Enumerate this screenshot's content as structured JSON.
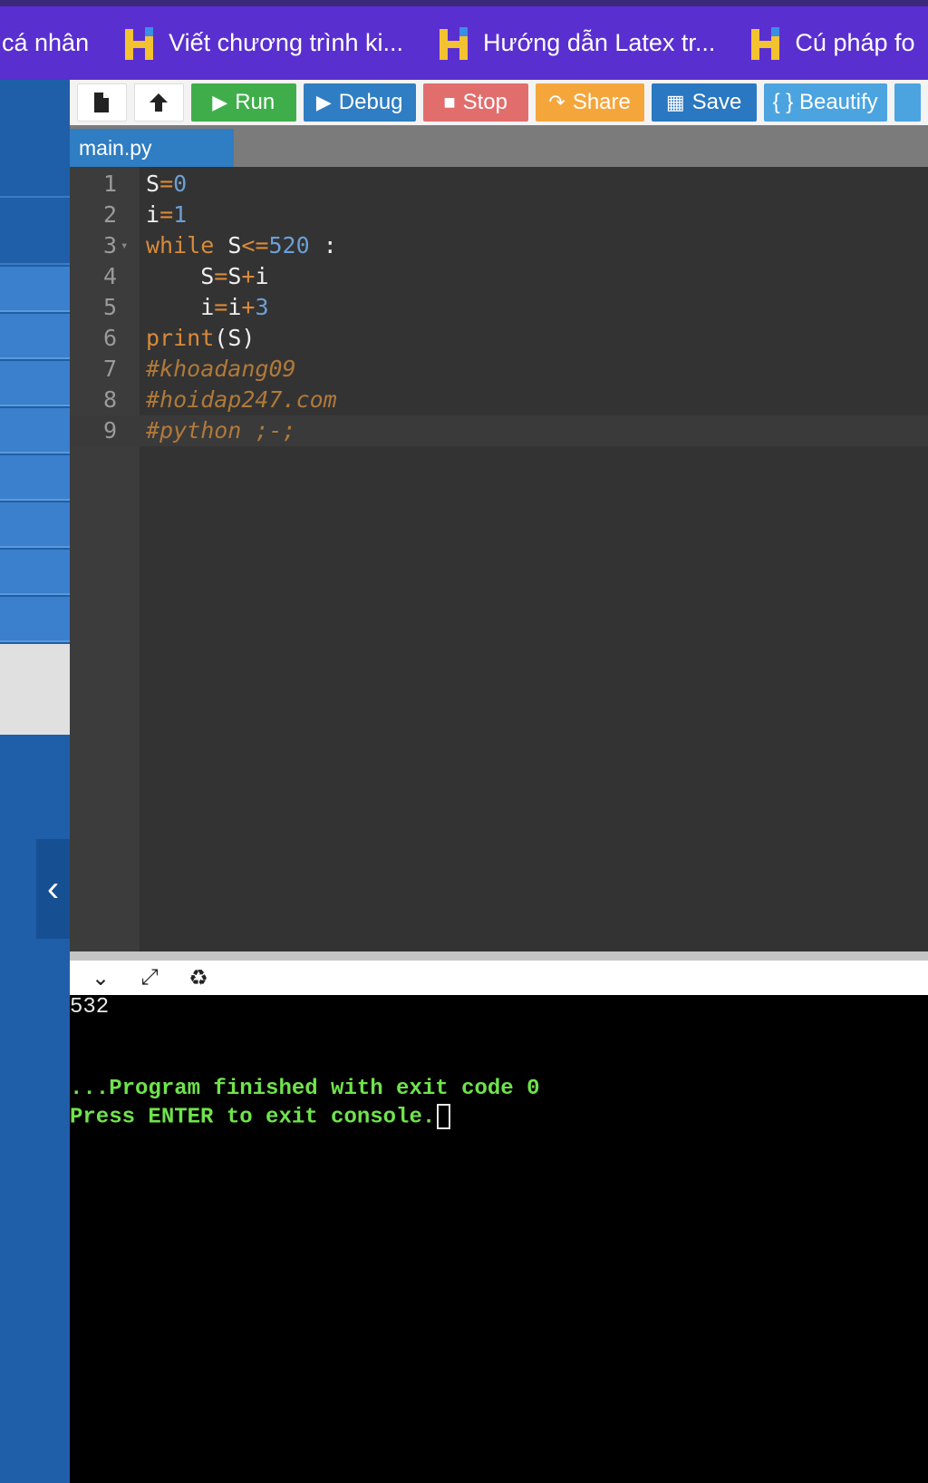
{
  "bookmarks": [
    {
      "label": "cá nhân",
      "icon": "none"
    },
    {
      "label": "Viết chương trình ki...",
      "icon": "h-logo-icon"
    },
    {
      "label": "Hướng dẫn Latex tr...",
      "icon": "h-logo-icon"
    },
    {
      "label": "Cú pháp fo",
      "icon": "h-logo-icon"
    }
  ],
  "toolbar": {
    "run_label": "Run",
    "debug_label": "Debug",
    "stop_label": "Stop",
    "share_label": "Share",
    "save_label": "Save",
    "beautify_label": "{ } Beautify"
  },
  "tab": {
    "filename": "main.py"
  },
  "editor": {
    "lines": [
      "1",
      "2",
      "3",
      "4",
      "5",
      "6",
      "7",
      "8",
      "9"
    ]
  },
  "console": {
    "output_value": "532",
    "finished_msg": "...Program finished with exit code 0",
    "press_msg": "Press ENTER to exit console."
  },
  "colors": {
    "bookmark_bar": "#5a2fcf",
    "run": "#3fae4a",
    "debug": "#2f7dc2",
    "stop": "#e26d6d",
    "share": "#f5a63b",
    "save": "#2a78c1",
    "beautify": "#4ba4e0",
    "console_green": "#6fe34c"
  }
}
